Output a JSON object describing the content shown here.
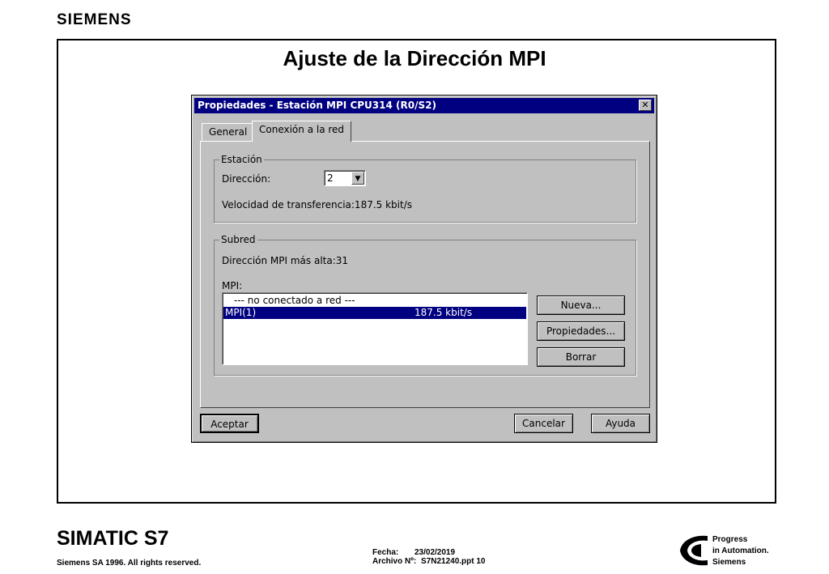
{
  "brand": "SIEMENS",
  "slide_title": "Ajuste de la Dirección MPI",
  "dialog": {
    "title": "Propiedades - Estación MPI  CPU314 (R0/S2)",
    "close_glyph": "✕",
    "tabs": [
      {
        "label": "General",
        "active": false
      },
      {
        "label": "Conexión a la red",
        "active": true
      }
    ],
    "station_group": {
      "label": "Estación",
      "address_label": "Dirección:",
      "address_value": "2",
      "speed_text": "Velocidad de transferencia:187.5 kbit/s"
    },
    "subnet_group": {
      "label": "Subred",
      "highest_address_text": "Dirección MPI más alta:31",
      "mpi_label": "MPI:",
      "list": [
        {
          "name": "--- no conectado a red ---",
          "speed": "",
          "selected": false
        },
        {
          "name": "MPI(1)",
          "speed": "187.5 kbit/s",
          "selected": true
        }
      ],
      "buttons": {
        "new": "Nueva...",
        "properties": "Propiedades...",
        "delete": "Borrar"
      }
    },
    "footer_buttons": {
      "ok": "Aceptar",
      "cancel": "Cancelar",
      "help": "Ayuda"
    }
  },
  "footer": {
    "product": "SIMATIC S7",
    "copyright": "Siemens SA 1996. All rights reserved.",
    "date_label": "Fecha:",
    "date_value": "23/02/2019",
    "file_label": "Archivo Nº:",
    "file_value": "S7N21240.ppt 10",
    "tagline": [
      "Progress",
      "in Automation.",
      "Siemens"
    ]
  }
}
